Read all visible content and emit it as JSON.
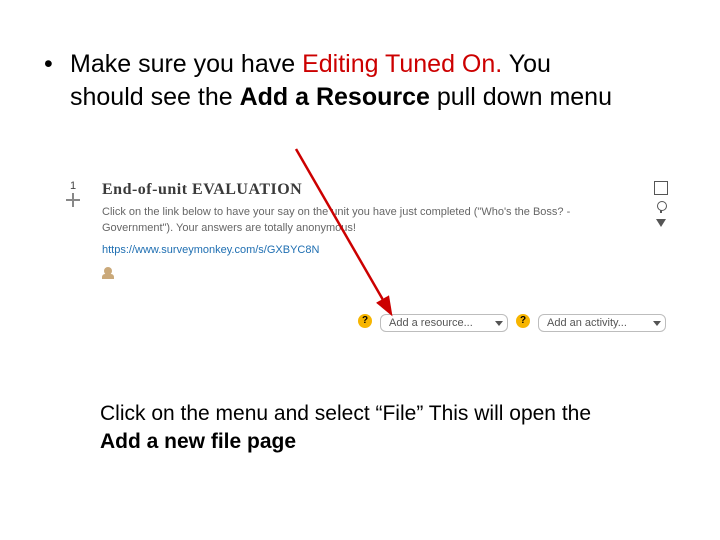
{
  "bullet": {
    "part1": "Make sure you have ",
    "editing_text": "Editing Tuned On",
    "period": ". ",
    "part2": "You should see the ",
    "bold_add": "Add a Resource",
    "part3": " pull down menu"
  },
  "moodle": {
    "section_number": "1",
    "title": "End-of-unit EVALUATION",
    "desc": "Click on the link below to have your say on the unit you have just completed (\"Who's the Boss? - Government\"). Your answers are totally anonymous!",
    "link": "https://www.surveymonkey.com/s/GXBYC8N",
    "add_resource_label": "Add a resource...",
    "add_activity_label": "Add an activity..."
  },
  "instruction2": {
    "part1": "Click on the menu and select “File” This will open the ",
    "bold": "Add a new file page"
  },
  "colors": {
    "highlight": "#cc0000",
    "link": "#1f6fb2",
    "pale_text": "#666666"
  }
}
